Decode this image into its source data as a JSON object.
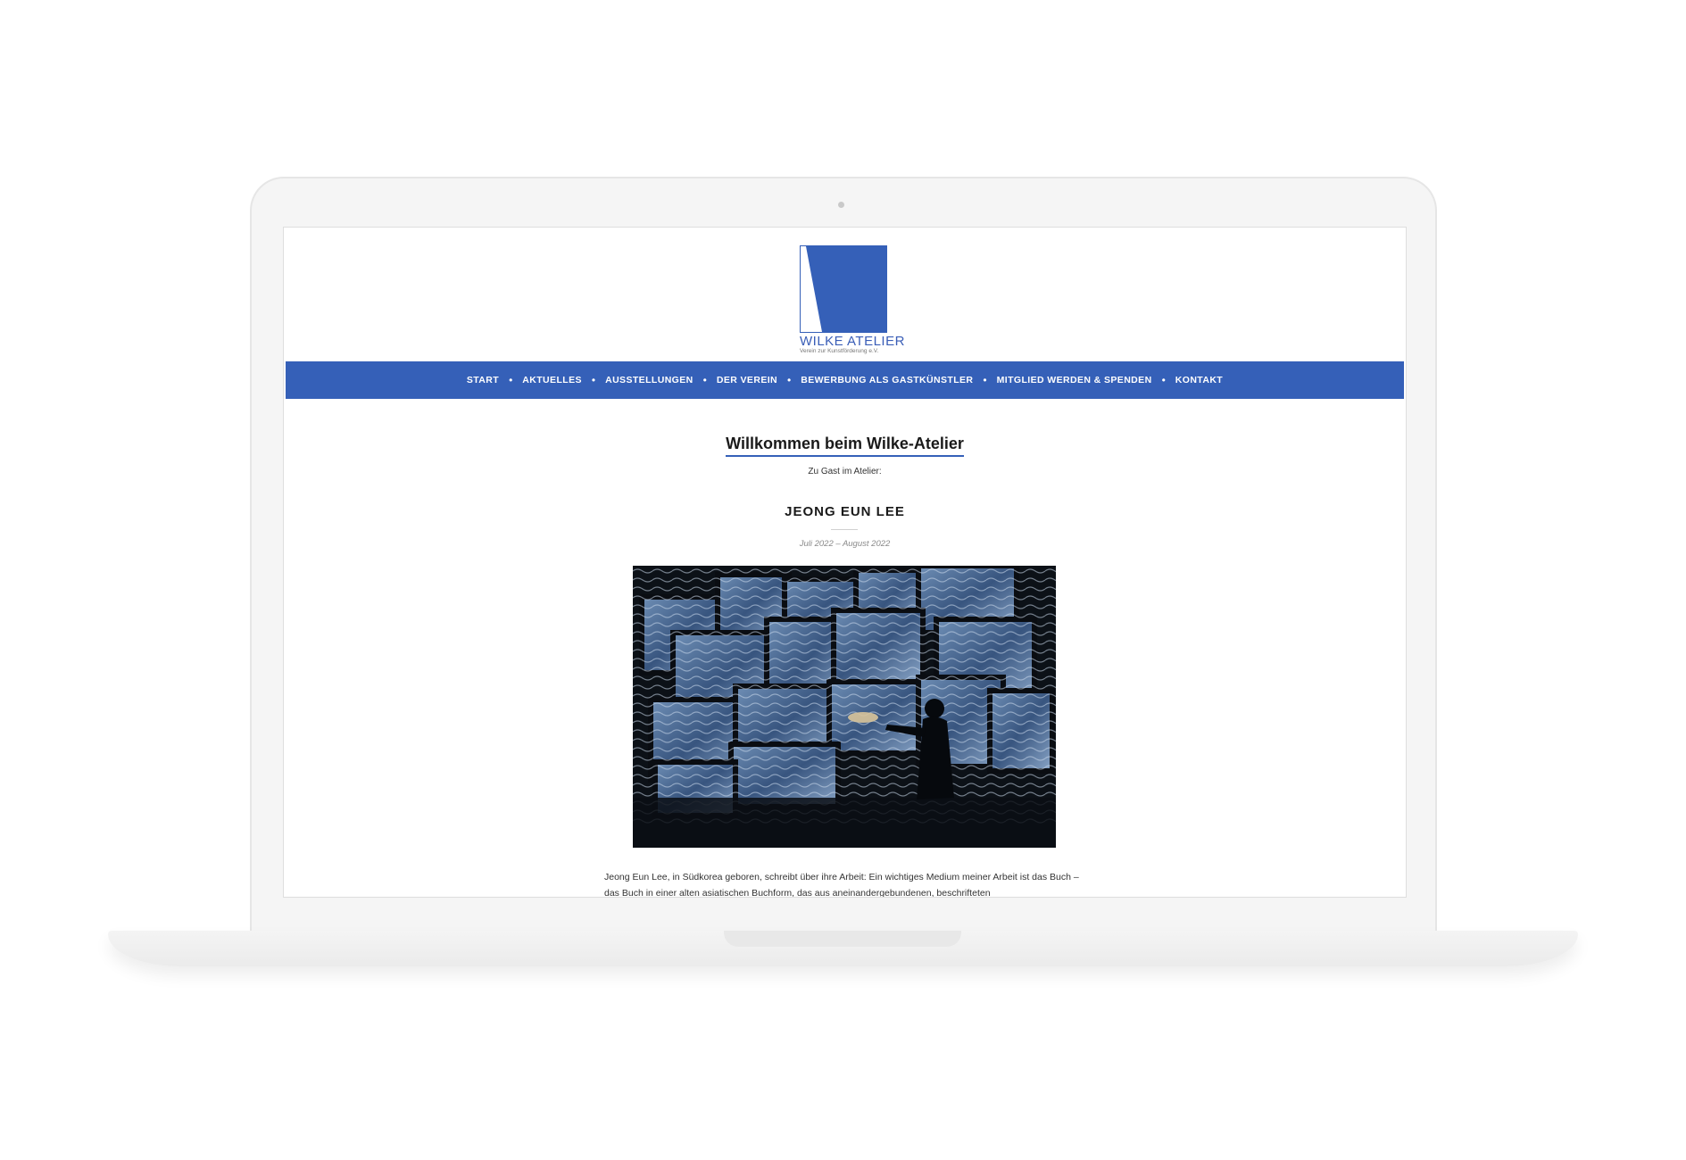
{
  "site": {
    "logo_title": "WILKE ATELIER",
    "logo_subtitle": "Verein zur Kunstförderung e.V.",
    "brand_color": "#3560b8"
  },
  "nav": {
    "items": [
      {
        "label": "START"
      },
      {
        "label": "AKTUELLES"
      },
      {
        "label": "AUSSTELLUNGEN"
      },
      {
        "label": "DER VEREIN"
      },
      {
        "label": "BEWERBUNG ALS GASTKÜNSTLER"
      },
      {
        "label": "MITGLIED WERDEN & SPENDEN"
      },
      {
        "label": "KONTAKT"
      }
    ],
    "separator": "•"
  },
  "main": {
    "heading": "Willkommen beim Wilke-Atelier",
    "guest_label": "Zu Gast im Atelier:",
    "artist_name": "JEONG EUN LEE",
    "dates": "Juli 2022 – August 2022",
    "photo_icon": "installation-photo",
    "body_text": "Jeong Eun Lee, in Südkorea geboren, schreibt über ihre Arbeit: Ein wichtiges Medium meiner Arbeit ist das Buch – das Buch in einer alten asiatischen Buchform, das aus aneinandergebundenen, beschrifteten"
  }
}
